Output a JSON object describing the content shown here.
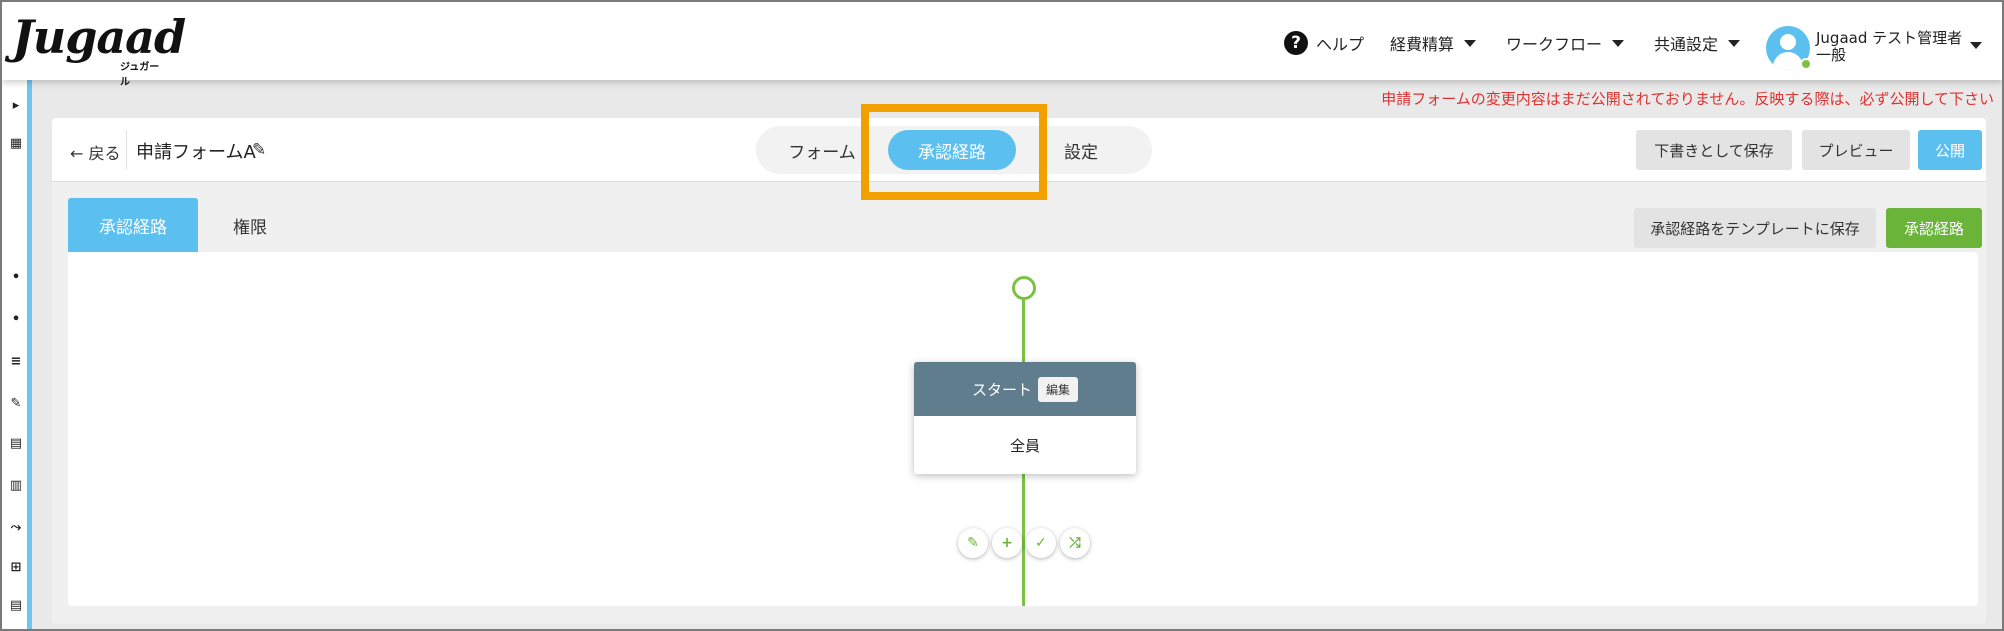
{
  "header": {
    "logo": "Jugaad",
    "logo_sub": "ジュガール",
    "help_label": "ヘルプ",
    "menus": [
      "経費精算",
      "ワークフロー",
      "共通設定"
    ],
    "user_name": "Jugaad テスト管理者",
    "user_role": "一般"
  },
  "notice": "申請フォームの変更内容はまだ公開されておりません。反映する際は、必ず公開して下さい",
  "editor": {
    "back_label": "← 戻る",
    "form_title": "申請フォームA",
    "tabs": [
      "フォーム",
      "承認経路",
      "設定"
    ],
    "active_tab": "承認経路",
    "buttons": {
      "save_draft": "下書きとして保存",
      "preview": "プレビュー",
      "publish": "公開"
    }
  },
  "route": {
    "subtabs": [
      "承認経路",
      "権限"
    ],
    "active_subtab": "承認経路",
    "save_template": "承認経路をテンプレートに保存",
    "route_button": "承認経路",
    "node": {
      "title": "スタート",
      "edit_label": "編集",
      "body": "全員"
    },
    "actions": [
      "pencil-icon",
      "add-user-icon",
      "check-icon",
      "shuffle-icon"
    ]
  },
  "colors": {
    "accent_blue": "#5bc0f0",
    "accent_green": "#6ab43a",
    "highlight_orange": "#f2a000",
    "notice_red": "#e03131"
  }
}
